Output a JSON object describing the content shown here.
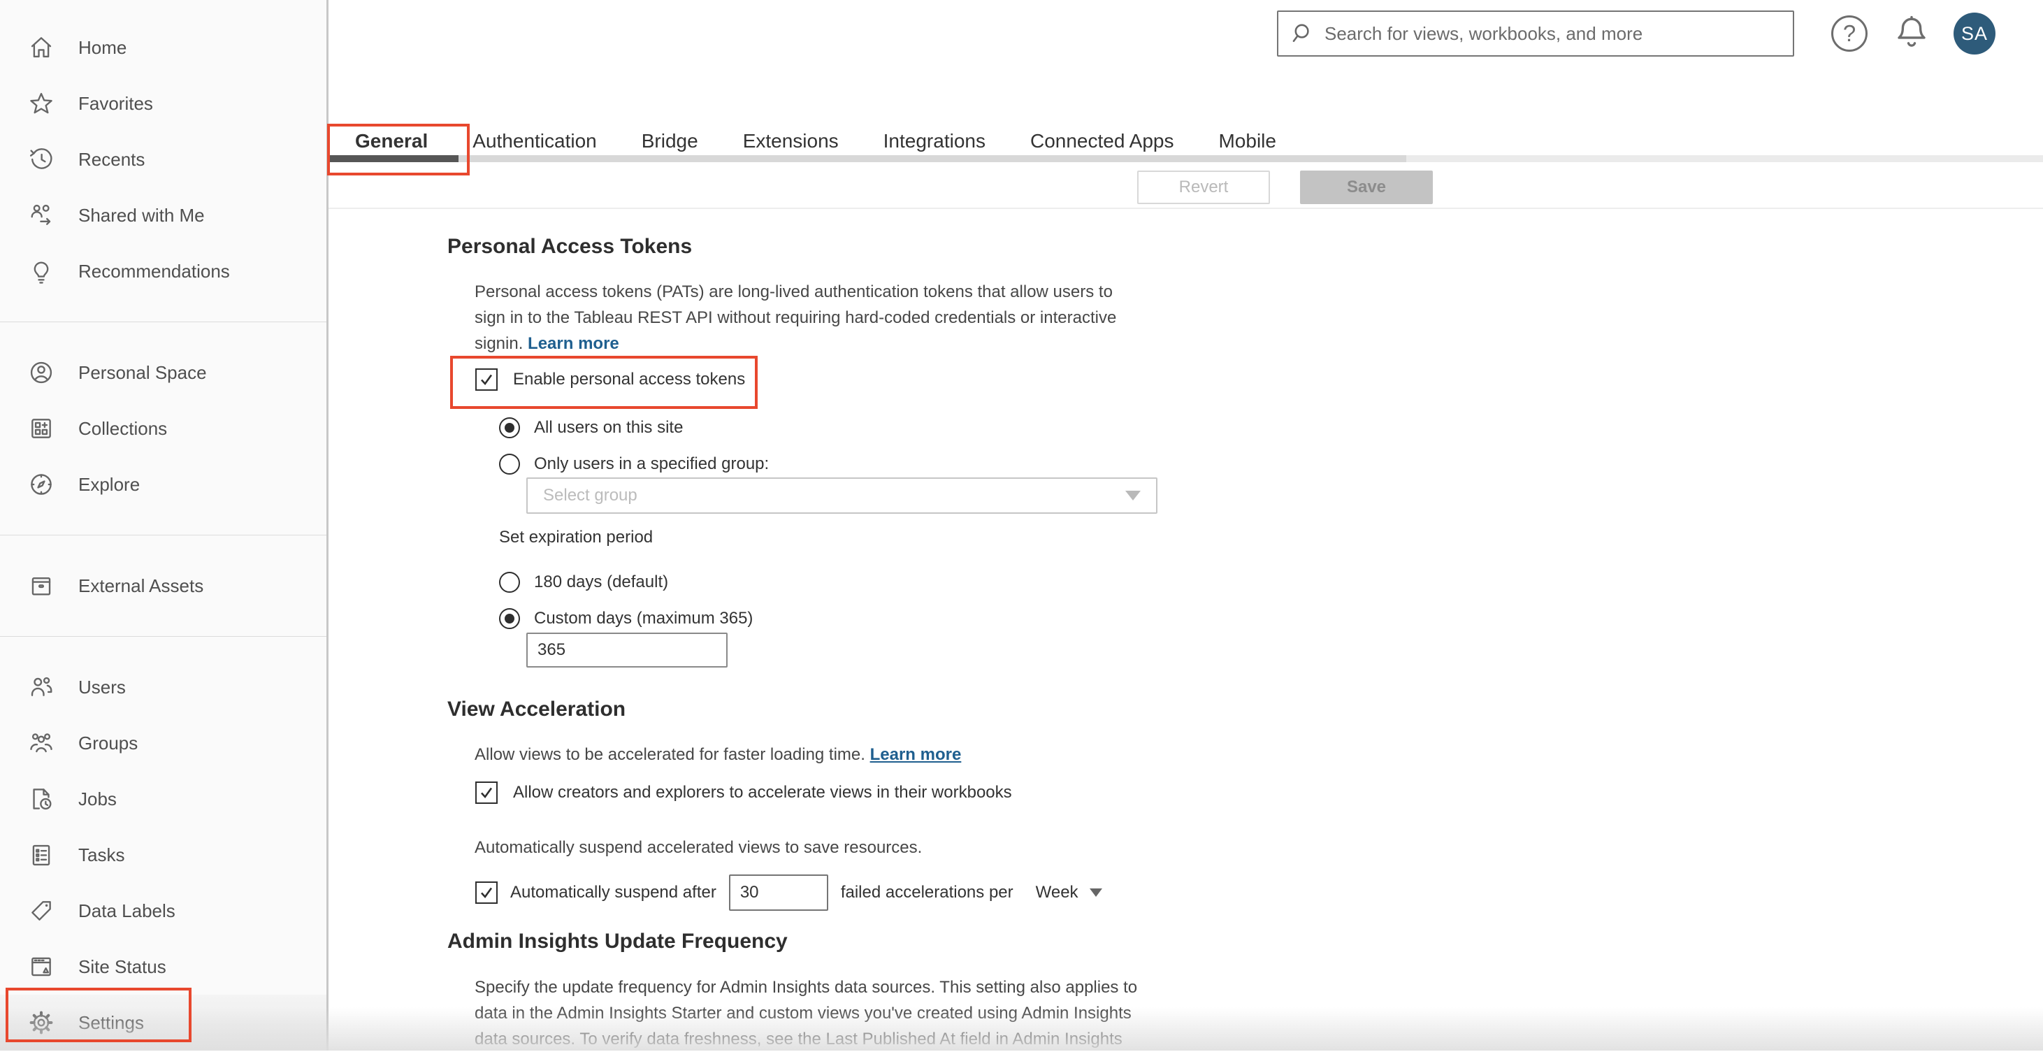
{
  "header": {
    "search_placeholder": "Search for views, workbooks, and more",
    "help_glyph": "?",
    "avatar_initials": "SA"
  },
  "sidebar": {
    "sections": [
      {
        "items": [
          {
            "label": "Home",
            "icon": "home-icon"
          },
          {
            "label": "Favorites",
            "icon": "star-icon"
          },
          {
            "label": "Recents",
            "icon": "recents-clock-icon"
          },
          {
            "label": "Shared with Me",
            "icon": "shared-with-me-icon"
          },
          {
            "label": "Recommendations",
            "icon": "lightbulb-icon"
          }
        ]
      },
      {
        "items": [
          {
            "label": "Personal Space",
            "icon": "person-circle-icon"
          },
          {
            "label": "Collections",
            "icon": "collections-icon"
          },
          {
            "label": "Explore",
            "icon": "compass-icon"
          }
        ]
      },
      {
        "items": [
          {
            "label": "External Assets",
            "icon": "archive-box-icon"
          }
        ]
      },
      {
        "items": [
          {
            "label": "Users",
            "icon": "users-icon"
          },
          {
            "label": "Groups",
            "icon": "groups-icon"
          },
          {
            "label": "Jobs",
            "icon": "jobs-icon"
          },
          {
            "label": "Tasks",
            "icon": "tasks-icon"
          },
          {
            "label": "Data Labels",
            "icon": "tag-icon"
          },
          {
            "label": "Site Status",
            "icon": "site-status-icon"
          },
          {
            "label": "Settings",
            "icon": "gear-icon",
            "selected": true
          }
        ]
      }
    ]
  },
  "tabs": {
    "items": [
      {
        "label": "General",
        "selected": true
      },
      {
        "label": "Authentication"
      },
      {
        "label": "Bridge"
      },
      {
        "label": "Extensions"
      },
      {
        "label": "Integrations"
      },
      {
        "label": "Connected Apps"
      },
      {
        "label": "Mobile"
      }
    ]
  },
  "actions": {
    "revert": "Revert",
    "save": "Save"
  },
  "sections": {
    "pat": {
      "title": "Personal Access Tokens",
      "description": "Personal access tokens (PATs) are long-lived authentication tokens that allow users to sign in to the Tableau REST API without requiring hard-coded credentials or interactive signin.",
      "learn_more": "Learn more",
      "enable_label": "Enable personal access tokens",
      "enable_checked": true,
      "radio_all_users": "All users on this site",
      "radio_all_users_selected": true,
      "radio_group": "Only users in a specified group:",
      "radio_group_selected": false,
      "select_group_placeholder": "Select group",
      "expiration_label": "Set expiration period",
      "radio_180": "180 days (default)",
      "radio_180_selected": false,
      "radio_custom": "Custom days (maximum 365)",
      "radio_custom_selected": true,
      "custom_days_value": "365"
    },
    "view_acceleration": {
      "title": "View Acceleration",
      "description": "Allow views to be accelerated for faster loading time.",
      "learn_more": "Learn more",
      "allow_label": "Allow creators and explorers to accelerate views in their workbooks",
      "allow_checked": true,
      "suspend_description": "Automatically suspend accelerated views to save resources.",
      "suspend_checked": true,
      "suspend_prefix": "Automatically suspend after",
      "suspend_value": "30",
      "suspend_suffix": "failed accelerations per",
      "period_value": "Week"
    },
    "admin_insights": {
      "title": "Admin Insights Update Frequency",
      "description": "Specify the update frequency for Admin Insights data sources. This setting also applies to data in the Admin Insights Starter and custom views you've created using Admin Insights data sources. To verify data freshness, see the Last Published At field in Admin Insights"
    }
  },
  "colors": {
    "annotation_red": "#e8482e",
    "link_blue": "#1f5f8f",
    "avatar_bg": "#2e5b7a",
    "sidebar_bg": "#fafafa",
    "tab_thumb": "#565656",
    "save_button_bg": "#c3c3c3"
  }
}
